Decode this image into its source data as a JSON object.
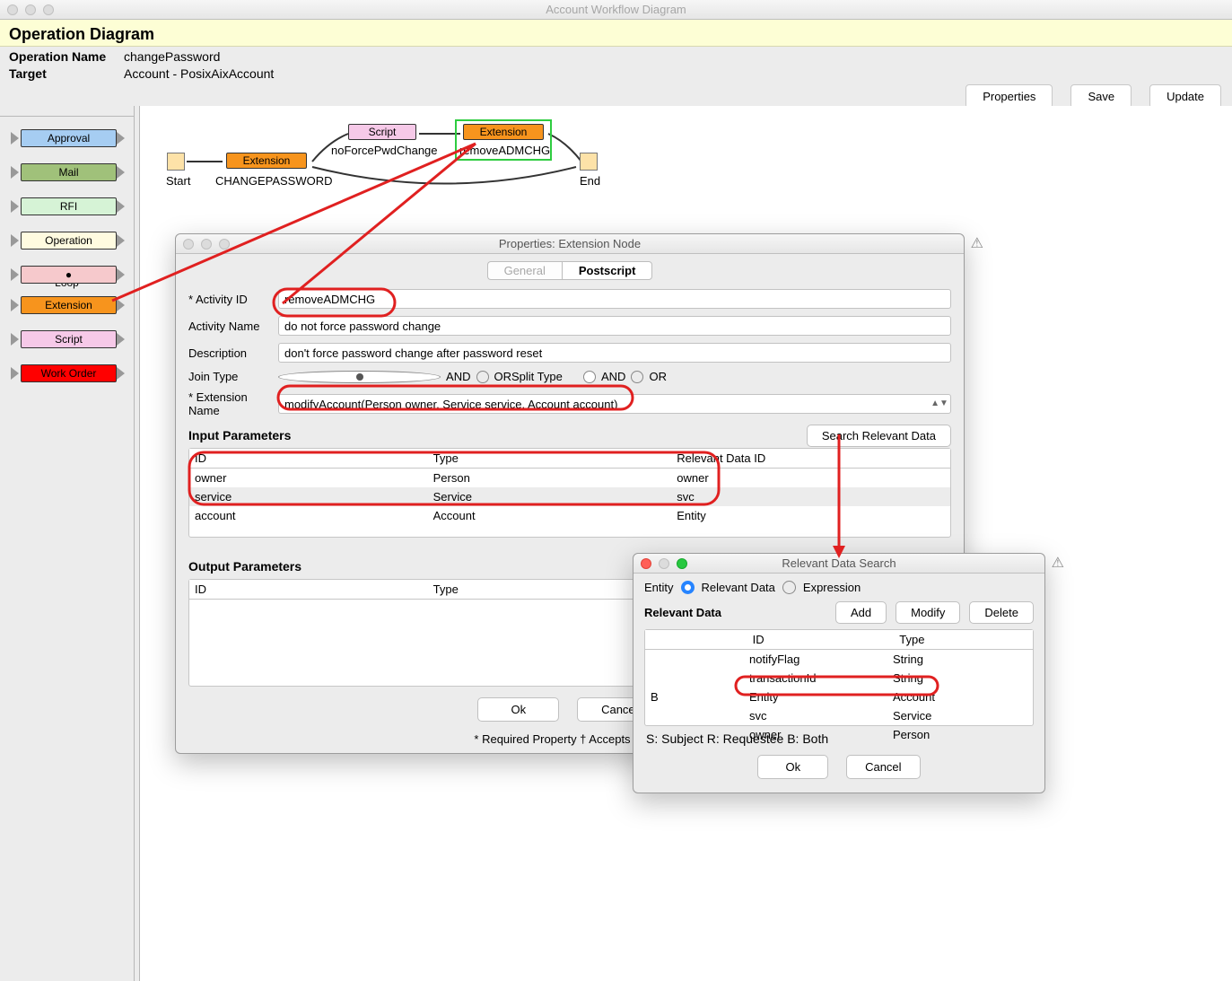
{
  "window_title": "Account Workflow Diagram",
  "header_title": "Operation Diagram",
  "op_name_label": "Operation Name",
  "op_name_value": "changePassword",
  "target_label": "Target",
  "target_value": "Account - PosixAixAccount",
  "buttons": {
    "properties": "Properties",
    "save": "Save",
    "update": "Update"
  },
  "palette": {
    "approval": "Approval",
    "mail": "Mail",
    "rfi": "RFI",
    "operation": "Operation",
    "loop": "Loop",
    "extension": "Extension",
    "script": "Script",
    "workorder": "Work Order"
  },
  "diagram": {
    "start": "Start",
    "end": "End",
    "ext1": "Extension",
    "ext1_sub": "CHANGEPASSWORD",
    "script": "Script",
    "script_sub": "noForcePwdChange",
    "ext2": "Extension",
    "ext2_sub": "removeADMCHG"
  },
  "dialog": {
    "title": "Properties: Extension Node",
    "tabs": {
      "general": "General",
      "postscript": "Postscript"
    },
    "activity_id_label": "* Activity ID",
    "activity_id_value": "removeADMCHG",
    "activity_name_label": "Activity Name",
    "activity_name_value": "do not force password change",
    "description_label": "Description",
    "description_value": "don't force password change after password reset",
    "join_type_label": "Join Type",
    "split_type_label": "Split Type",
    "and": "AND",
    "or": "OR",
    "ext_name_label": "* Extension Name",
    "ext_name_value": "modifyAccount(Person owner, Service service, Account account)",
    "input_params": "Input Parameters",
    "output_params": "Output Parameters",
    "search_relevant": "Search Relevant Data",
    "col_id": "ID",
    "col_type": "Type",
    "col_rel": "Relevant Data ID",
    "rows": [
      {
        "id": "owner",
        "type": "Person",
        "rel": "owner"
      },
      {
        "id": "service",
        "type": "Service",
        "rel": "svc"
      },
      {
        "id": "account",
        "type": "Account",
        "rel": "Entity"
      }
    ],
    "ok": "Ok",
    "cancel": "Cancel",
    "footnote": "* Required Property † Accepts text te"
  },
  "search": {
    "title": "Relevant Data Search",
    "entity": "Entity",
    "relevant_data": "Relevant Data",
    "expression": "Expression",
    "add": "Add",
    "modify": "Modify",
    "delete": "Delete",
    "section": "Relevant Data",
    "col_blank": "",
    "col_id": "ID",
    "col_type": "Type",
    "rows": [
      {
        "b": "",
        "id": "notifyFlag",
        "type": "String"
      },
      {
        "b": "",
        "id": "transactionId",
        "type": "String"
      },
      {
        "b": "B",
        "id": "Entity",
        "type": "Account"
      },
      {
        "b": "",
        "id": "svc",
        "type": "Service"
      },
      {
        "b": "",
        "id": "owner",
        "type": "Person"
      }
    ],
    "legend": "S: Subject    R: Requestee    B: Both",
    "ok": "Ok",
    "cancel": "Cancel"
  }
}
